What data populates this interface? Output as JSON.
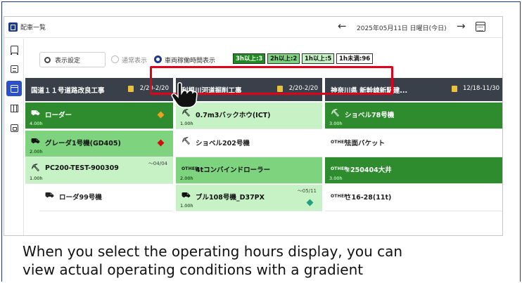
{
  "app": {
    "title": "配車一覧",
    "date_label": "2025年05月11日 日曜日(今日)",
    "prev_glyph": "←",
    "next_glyph": "→"
  },
  "sidebar": {
    "items": [
      {
        "icon": "truck-icon",
        "active": false
      },
      {
        "icon": "document-icon",
        "active": false
      },
      {
        "icon": "calendar-icon",
        "active": true
      },
      {
        "icon": "map-icon",
        "active": false
      },
      {
        "icon": "wallet-icon",
        "active": false
      }
    ]
  },
  "settings": {
    "display_settings_label": "表示設定",
    "radio_normal_label": "通常表示",
    "radio_operating_label": "車両稼働時間表示",
    "badges": [
      {
        "label": "3h以上:3",
        "bg": "#1f8a1f",
        "fg": "#ffffff"
      },
      {
        "label": "2h以上:2",
        "bg": "#7ed37e",
        "fg": "#111111"
      },
      {
        "label": "1h以上:5",
        "bg": "#c6f2c6",
        "fg": "#111111"
      },
      {
        "label": "1h未満:96",
        "bg": "#ffffff",
        "fg": "#111111"
      }
    ]
  },
  "columns": [
    {
      "title": "国道１１号道路改良工事",
      "date": "2/20-2/20",
      "rows": [
        {
          "name": "ローダー",
          "icon": "⛟",
          "hours": "4.00h",
          "shade": "dark",
          "marker": "#f0a020",
          "sub": ""
        },
        {
          "name": "グレーダ1号機(GD405)",
          "icon": "⛟",
          "hours": "2.00h",
          "shade": "mid",
          "marker": "#d01010",
          "sub": ""
        },
        {
          "name": "PC200-TEST-900309",
          "icon": "⛏",
          "hours": "1.00h",
          "shade": "light",
          "marker": "",
          "sub": "～04/04"
        },
        {
          "name": "ローダ99号機",
          "icon": "⛟",
          "hours": "",
          "shade": "none",
          "marker": "",
          "sub": ""
        }
      ]
    },
    {
      "title": "利根川河道掘削工事",
      "date": "2/20-2/20",
      "rows": [
        {
          "name": "0.7m3バックホウ(ICT)",
          "icon": "⛏",
          "hours": "1.00h",
          "shade": "light",
          "marker": "",
          "sub": ""
        },
        {
          "name": "ショベル202号機",
          "icon": "⛏",
          "hours": "",
          "shade": "none",
          "marker": "",
          "sub": ""
        },
        {
          "name": "4tコンバインドローラー",
          "icon": "OTHER",
          "hours": "2.00h",
          "shade": "mid",
          "marker": "",
          "sub": ""
        },
        {
          "name": "ブル108号機_D37PX",
          "icon": "⛟",
          "hours": "1.00h",
          "shade": "light",
          "marker": "#20a080",
          "sub": "～05/11"
        }
      ]
    },
    {
      "title": "神奈川県 新幹線新駅建...",
      "date": "12/18-11/30",
      "rows": [
        {
          "name": "ショベル78号機",
          "icon": "⛏",
          "hours": "3.00h",
          "shade": "dark",
          "marker": "",
          "sub": ""
        },
        {
          "name": "法面バケット",
          "icon": "OTHER",
          "hours": "",
          "shade": "none",
          "marker": "",
          "sub": ""
        },
        {
          "name": "②250404大井",
          "icon": "OTHER",
          "hours": "3.00h",
          "shade": "dark",
          "marker": "",
          "sub": ""
        },
        {
          "name": "さ16-28(11t)",
          "icon": "OTHER",
          "hours": "",
          "shade": "none",
          "marker": "",
          "sub": ""
        }
      ]
    }
  ],
  "caption": {
    "line1": "When you select the operating hours display, you can",
    "line2": "view actual operating conditions with a gradient"
  }
}
